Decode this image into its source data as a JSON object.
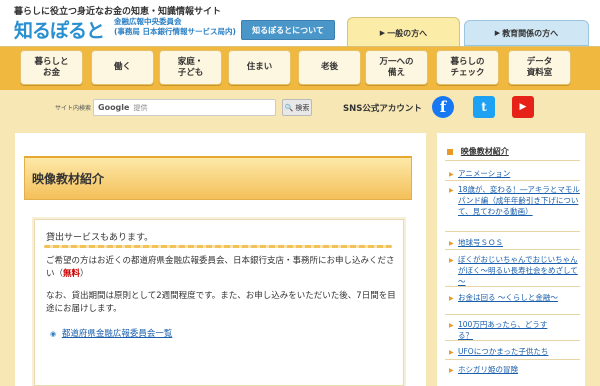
{
  "header": {
    "tagline": "暮らしに役立つ身近なお金の知恵・知識情報サイト",
    "logo": "知るぽると",
    "org_line1": "金融広報中央委員会",
    "org_line2": "(事務局 日本銀行情報サービス局内)",
    "about_button": "知るぽるとについて",
    "tab_general": "一般の方へ",
    "tab_education": "教育関係の方へ"
  },
  "nav": [
    "暮らしと\nお金",
    "働く",
    "家庭・\n子ども",
    "住まい",
    "老後",
    "万一への\n備え",
    "暮らしの\nチェック",
    "データ\n資料室"
  ],
  "search": {
    "label": "サイト内検索",
    "google": "Google",
    "placeholder": "提供",
    "button": "検索"
  },
  "sns": {
    "label": "SNS公式アカウント",
    "facebook": "f",
    "twitter": "t",
    "youtube": "▶"
  },
  "main": {
    "page_title": "映像教材紹介",
    "box_heading": "貸出サービスもあります。",
    "para1_a": "ご希望の方はお近くの都道府県金融広報委員会、日本銀行支店・事務所にお申し込みください（",
    "para1_red": "無料",
    "para1_b": "）",
    "para2": "なお、貸出期間は原則として2週間程度です。また、お申し込みをいただいた後、7日間を目途にお届けします。",
    "link": "都道府県金融広報委員会一覧"
  },
  "sidebar": {
    "title": "映像教材紹介",
    "items": [
      "アニメーション",
      "18歳が、変わる！―アキラとマモル パンド編（成年年齢引き下げについて、見てわかる動画）",
      "地球号ＳＯＳ",
      "ぼくがおじいちゃんでおじいちゃんがぼく～明るい長寿社会をめざして～",
      "お金は回る ～くらしと金融～",
      "100万円あったら、どうする？",
      "UFOにつかまった子供たち",
      "ホシガリ姫の冒険"
    ]
  },
  "colors": {
    "nav_bg": "#f0b83f",
    "page_bg": "#f6e7b4",
    "link": "#1a5fae",
    "accent": "#e89a26"
  }
}
